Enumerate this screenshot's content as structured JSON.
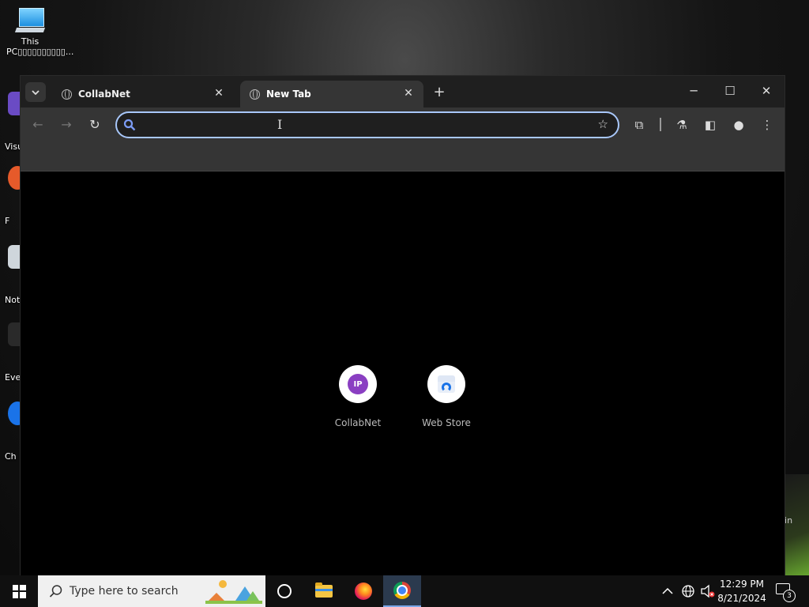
{
  "desktop": {
    "icons": [
      {
        "label": "This PC▯▯▯▯▯▯▯▯▯▯..."
      },
      {
        "label": "Visu"
      },
      {
        "label": "F"
      },
      {
        "label": "Not"
      },
      {
        "label": "Eve"
      },
      {
        "label": "Ch"
      }
    ],
    "right_text": "lin"
  },
  "browser": {
    "tabs": [
      {
        "title": "CollabNet",
        "active": false
      },
      {
        "title": "New Tab",
        "active": true
      }
    ],
    "omnibox": {
      "value": "",
      "placeholder": ""
    },
    "shortcuts": [
      {
        "label": "CollabNet",
        "badge": "IP",
        "badge_color": "#8a3fc2"
      },
      {
        "label": "Web Store",
        "icon": "chrome-web-store-icon"
      }
    ]
  },
  "taskbar": {
    "search_placeholder": "Type here to search",
    "time": "12:29 PM",
    "date": "8/21/2024",
    "notification_count": "3"
  },
  "colors": {
    "accent": "#a8c7fa",
    "tab_active": "#353535",
    "titlebar": "#1f1f1f"
  }
}
